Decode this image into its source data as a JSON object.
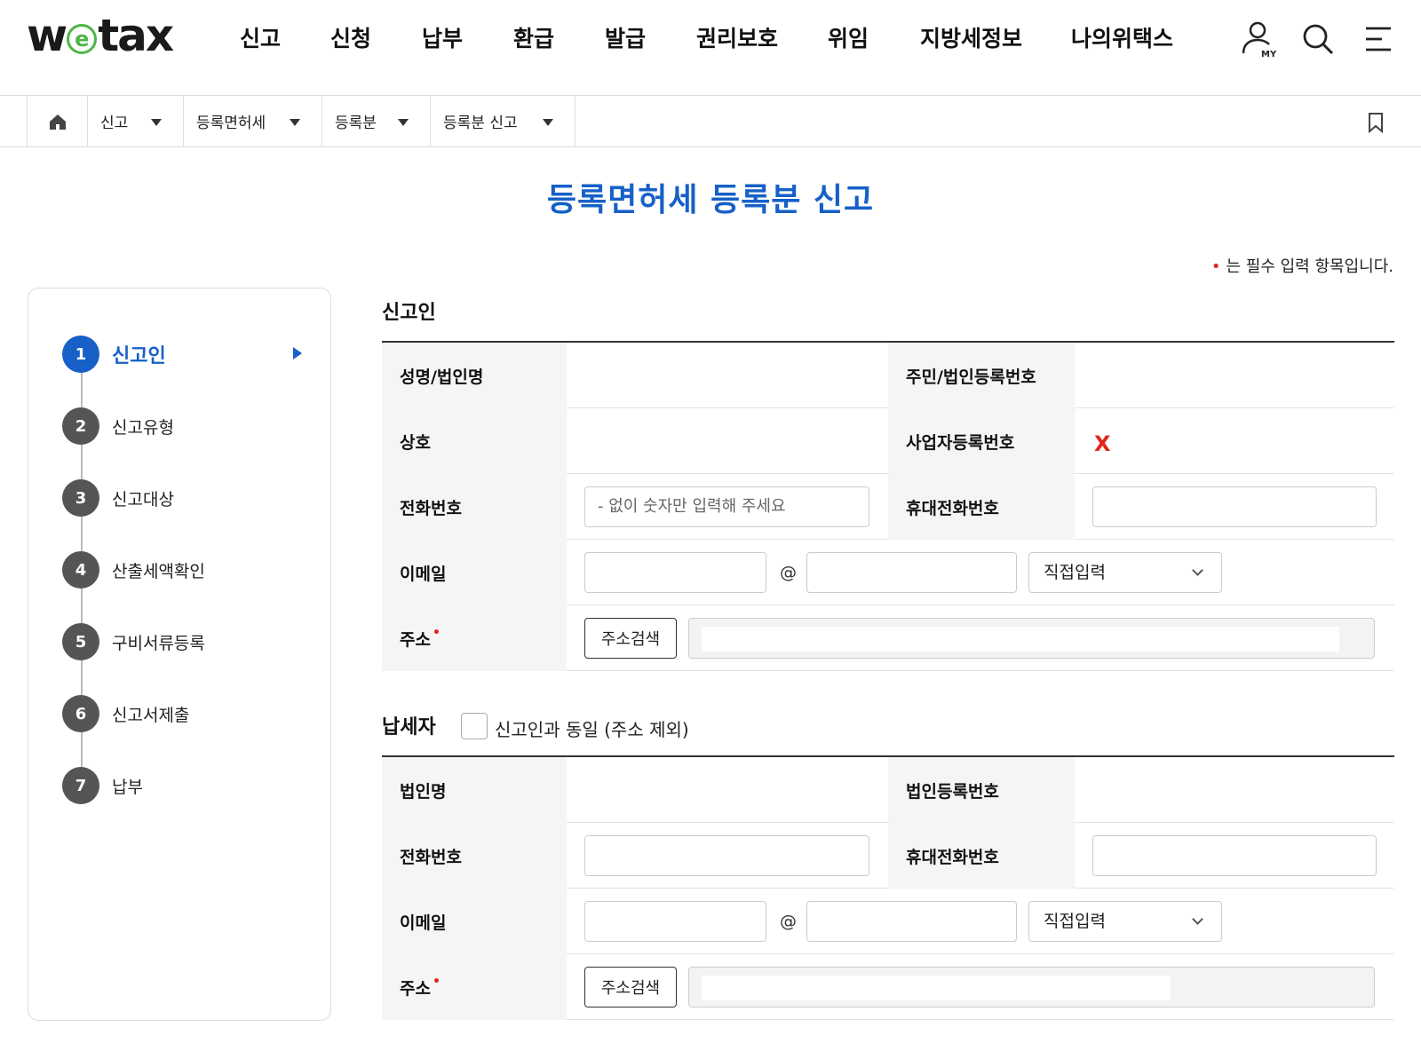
{
  "header": {
    "logo": {
      "pre": "w",
      "e": "e",
      "post": "tax"
    },
    "nav": [
      "신고",
      "신청",
      "납부",
      "환급",
      "발급",
      "권리보호",
      "위임",
      "지방세정보",
      "나의위택스"
    ],
    "my_icon_text": "MY"
  },
  "breadcrumb": {
    "items": [
      "신고",
      "등록면허세",
      "등록분",
      "등록분 신고"
    ]
  },
  "page": {
    "title": "등록면허세 등록분 신고",
    "required_dot": "•",
    "required_note": "는 필수 입력 항목입니다."
  },
  "steps": [
    {
      "num": "1",
      "label": "신고인"
    },
    {
      "num": "2",
      "label": "신고유형"
    },
    {
      "num": "3",
      "label": "신고대상"
    },
    {
      "num": "4",
      "label": "산출세액확인"
    },
    {
      "num": "5",
      "label": "구비서류등록"
    },
    {
      "num": "6",
      "label": "신고서제출"
    },
    {
      "num": "7",
      "label": "납부"
    }
  ],
  "reporter": {
    "title": "신고인",
    "name_label": "성명/법인명",
    "regno_label": "주민/법인등록번호",
    "trade_label": "상호",
    "bizno_label": "사업자등록번호",
    "bizno_value": "X",
    "phone_label": "전화번호",
    "phone_placeholder": "- 없이 숫자만 입력해 주세요",
    "mobile_label": "휴대전화번호",
    "email_label": "이메일",
    "at": "@",
    "email_domain_select": "직접입력",
    "address_label": "주소",
    "address_button": "주소검색"
  },
  "taxpayer": {
    "title": "납세자",
    "same_as_reporter_label": "신고인과 동일 (주소 제외)",
    "corp_name_label": "법인명",
    "corp_regno_label": "법인등록번호",
    "phone_label": "전화번호",
    "mobile_label": "휴대전화번호",
    "email_label": "이메일",
    "at": "@",
    "email_domain_select": "직접입력",
    "address_label": "주소",
    "address_button": "주소검색"
  },
  "colors": {
    "accent": "#1660c8",
    "required": "#e1261c",
    "logo_green": "#4cb648"
  }
}
